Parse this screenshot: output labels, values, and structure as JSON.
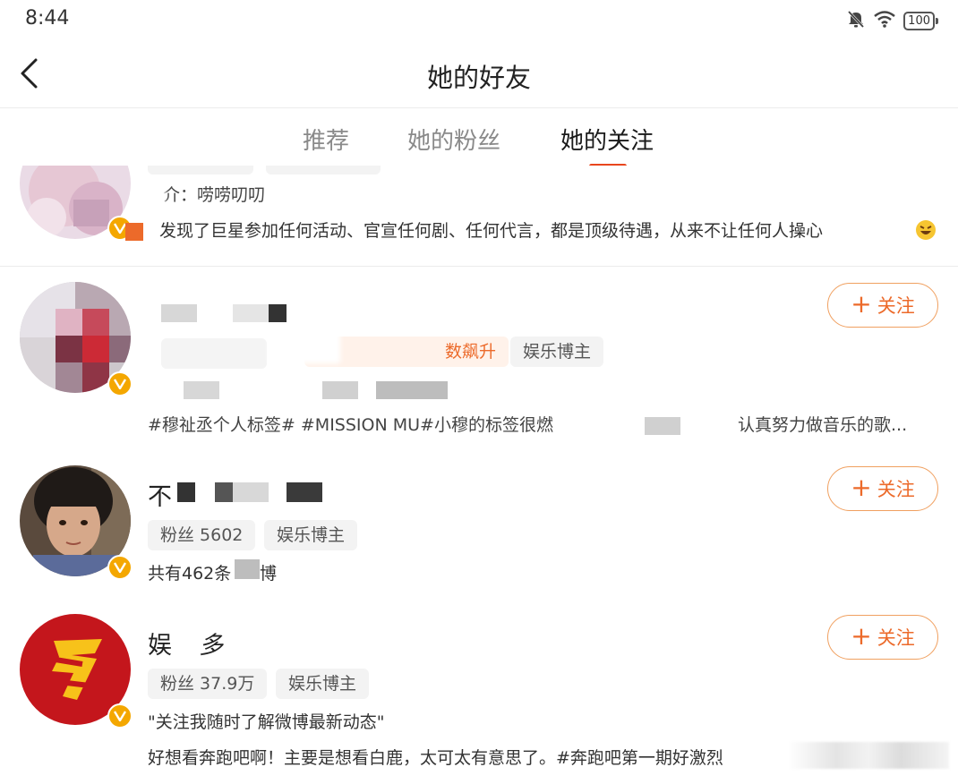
{
  "status": {
    "time": "8:44",
    "battery": "100"
  },
  "header": {
    "title": "她的好友"
  },
  "tabs": [
    {
      "label": "推荐"
    },
    {
      "label": "她的粉丝"
    },
    {
      "label": "她的关注"
    }
  ],
  "accent_color": "#e8461d",
  "users": [
    {
      "intro": "简介：唠唠叨叨",
      "intro_visible": "介：唠唠叨叨",
      "latest_post": "我发现了巨星参加任何活动、官宣任何剧、任何代言，都是顶级待遇，从来不让任何人操心",
      "latest_post_visible": "发现了巨星参加任何活动、官宣任何剧、任何代言，都是顶级待遇，从来不让任何人操心",
      "verified": true
    },
    {
      "name": "",
      "tags": [
        "人气飙升",
        "娱乐博主"
      ],
      "tag_hot_visible": "数飙升",
      "tag_visible": "娱乐博主",
      "latest_post_visible": "#穆祉丞个人标签# #MISSION MU#小穆的标签很燃",
      "latest_post_tail": "认真努力做音乐的歌...",
      "follow_label": "关注",
      "verified": true
    },
    {
      "name_visible": "不",
      "tags": [
        "粉丝 5602",
        "娱乐博主"
      ],
      "weibo_count": "共有462条微博",
      "weibo_count_left": "共有462条",
      "weibo_count_right": "博",
      "follow_label": "关注",
      "verified": true
    },
    {
      "name_visible": "娱",
      "name_tail": "多",
      "tags": [
        "粉丝 37.9万",
        "娱乐博主"
      ],
      "intro": "\"关注我随时了解微博最新动态\"",
      "latest_post": "好想看奔跑吧啊！主要是想看白鹿，太可太有意思了。#奔跑吧第一期好激烈",
      "follow_label": "关注",
      "verified": true
    }
  ]
}
